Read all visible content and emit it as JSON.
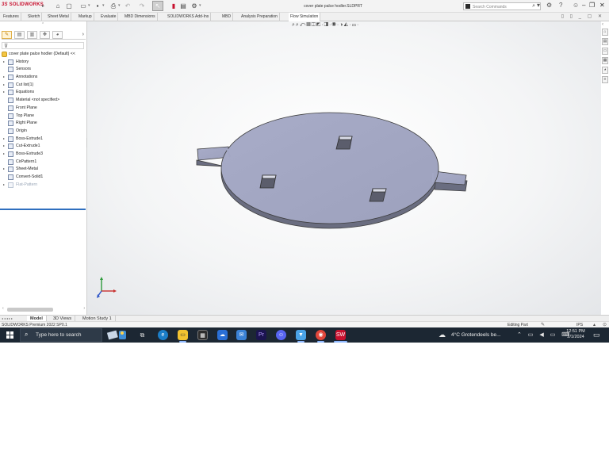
{
  "titlebar": {
    "logo_text": "SOLIDWORKS",
    "document_title": "cover plate palce hodler.SLDPRT",
    "search_placeholder": "Search Commands",
    "icons": [
      "home-icon",
      "new-icon",
      "open-icon",
      "save-icon",
      "print-icon",
      "undo-icon",
      "redo-icon",
      "select-icon",
      "rebuild-icon",
      "file-properties-icon",
      "options-icon",
      "help-icon",
      "user-icon"
    ]
  },
  "command_tabs": [
    {
      "label": "Features",
      "active": false
    },
    {
      "label": "Sketch",
      "active": false
    },
    {
      "label": "Sheet Metal",
      "active": false
    },
    {
      "label": "Markup",
      "active": false
    },
    {
      "label": "Evaluate",
      "active": false
    },
    {
      "label": "MBD Dimensions",
      "active": false
    },
    {
      "label": "SOLIDWORKS Add-Ins",
      "active": false
    },
    {
      "label": "MBD",
      "active": false
    },
    {
      "label": "Analysis Preparation",
      "active": false
    },
    {
      "label": "Flow Simulation",
      "active": true
    }
  ],
  "feature_tree": {
    "root": "cover plate palce hodler (Default) <<",
    "items": [
      {
        "label": "History",
        "expandable": true,
        "icon": "history-icon"
      },
      {
        "label": "Sensors",
        "expandable": false,
        "icon": "sensors-icon"
      },
      {
        "label": "Annotations",
        "expandable": true,
        "icon": "annotations-icon"
      },
      {
        "label": "Cut list(1)",
        "expandable": true,
        "icon": "cut-list-icon"
      },
      {
        "label": "Equations",
        "expandable": true,
        "icon": "equations-icon"
      },
      {
        "label": "Material <not specified>",
        "expandable": false,
        "icon": "material-icon"
      },
      {
        "label": "Front Plane",
        "expandable": false,
        "icon": "plane-icon"
      },
      {
        "label": "Top Plane",
        "expandable": false,
        "icon": "plane-icon"
      },
      {
        "label": "Right Plane",
        "expandable": false,
        "icon": "plane-icon"
      },
      {
        "label": "Origin",
        "expandable": false,
        "icon": "origin-icon"
      },
      {
        "label": "Boss-Extrude1",
        "expandable": true,
        "icon": "boss-extrude-icon"
      },
      {
        "label": "Cut-Extrude1",
        "expandable": true,
        "icon": "cut-extrude-icon"
      },
      {
        "label": "Boss-Extrude3",
        "expandable": true,
        "icon": "boss-extrude-icon"
      },
      {
        "label": "CirPattern1",
        "expandable": false,
        "icon": "circular-pattern-icon"
      },
      {
        "label": "Sheet-Metal",
        "expandable": true,
        "icon": "sheet-metal-icon"
      },
      {
        "label": "Convert-Solid1",
        "expandable": false,
        "icon": "convert-solid-icon"
      },
      {
        "label": "Flat-Pattern",
        "expandable": true,
        "icon": "flat-pattern-icon",
        "suppressed": true
      }
    ]
  },
  "model_tabs": [
    {
      "label": "Model",
      "active": true
    },
    {
      "label": "3D Views",
      "active": false
    },
    {
      "label": "Motion Study 1",
      "active": false
    }
  ],
  "status": {
    "product": "SOLIDWORKS Premium 2022 SP0.1",
    "mode": "Editing Part",
    "units": "IPS"
  },
  "taskbar": {
    "search_text": "Type here to search",
    "weather": "4°C  Grotendeels be...",
    "time": "12:51 PM",
    "date": "2/1/2024",
    "apps": [
      "task-view-icon",
      "edge-icon",
      "file-explorer-icon",
      "store-icon",
      "onedrive-icon",
      "mail-icon",
      "premiere-icon",
      "discord-icon",
      "vpn-icon",
      "chrome-icon",
      "solidworks-icon"
    ]
  },
  "colors": {
    "part_face": "#a3a7c4",
    "part_edge": "#4a4a4a",
    "taskbar": "#1c2733",
    "accent": "#2f6fbf"
  }
}
